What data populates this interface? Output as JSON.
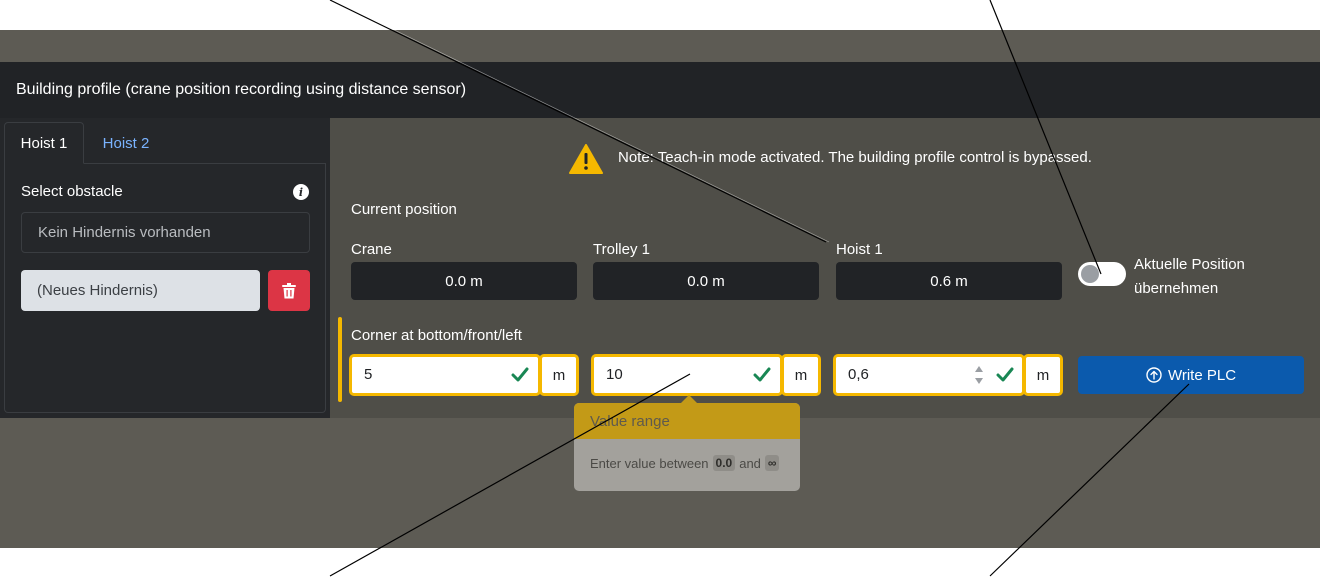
{
  "header": {
    "title": "Building profile (crane position recording using distance sensor)"
  },
  "tabs": [
    {
      "label": "Hoist 1",
      "active": true
    },
    {
      "label": "Hoist 2",
      "active": false
    }
  ],
  "sidebar": {
    "select_label": "Select obstacle",
    "info_icon": "info-icon",
    "empty_option": "Kein Hindernis vorhanden",
    "new_obstacle": "(Neues Hindernis)",
    "delete_icon": "trash-icon"
  },
  "note": {
    "icon": "warning-icon",
    "text": "Note: Teach-in mode activated. The building profile control is bypassed."
  },
  "current_position": {
    "title": "Current position",
    "crane": {
      "label": "Crane",
      "value": "0.0 m"
    },
    "trolley": {
      "label": "Trolley 1",
      "value": "0.0 m"
    },
    "hoist": {
      "label": "Hoist 1",
      "value": "0.6 m"
    }
  },
  "toggle": {
    "label": "Aktuelle Position übernehmen",
    "on": false
  },
  "corner": {
    "title": "Corner at bottom/front/left",
    "x": {
      "value": "5",
      "unit": "m"
    },
    "y": {
      "value": "10",
      "unit": "m"
    },
    "z": {
      "value": "0,6",
      "unit": "m"
    }
  },
  "write_button": {
    "label": "Write PLC",
    "icon": "upload-circle-icon"
  },
  "tooltip": {
    "title": "Value range",
    "prefix": "Enter value between",
    "min": "0.0",
    "conj": "and",
    "max": "∞"
  },
  "colors": {
    "accent": "#f5b800",
    "primary": "#0b5aad",
    "danger": "#dc3545",
    "valid": "#198754"
  }
}
